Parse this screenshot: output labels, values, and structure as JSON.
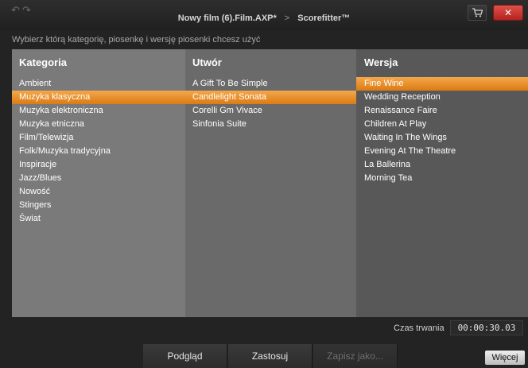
{
  "titlebar": {
    "undo_glyph": "↶",
    "redo_glyph": "↷",
    "project_title": "Nowy film (6).Film.AXP*",
    "arrow": ">",
    "app_name": "Scorefitter™",
    "cart_icon": "shopping-cart-icon",
    "close_glyph": "✕"
  },
  "instruction": "Wybierz którą kategorię, piosenkę i wersję piosenki chcesz użyć",
  "columns": {
    "category": {
      "header": "Kategoria",
      "items": [
        "Ambient",
        "Muzyka klasyczna",
        "Muzyka elektroniczna",
        "Muzyka etniczna",
        "Film/Telewizja",
        "Folk/Muzyka tradycyjna",
        "Inspiracje",
        "Jazz/Blues",
        "Nowość",
        "Stingers",
        "Świat"
      ],
      "selected_index": 1
    },
    "song": {
      "header": "Utwór",
      "items": [
        "A Gift To Be Simple",
        "Candlelight Sonata",
        "Corelli Gm Vivace",
        "Sinfonia Suite"
      ],
      "selected_index": 1
    },
    "version": {
      "header": "Wersja",
      "items": [
        "Fine Wine",
        "Wedding Reception",
        "Renaissance Faire",
        "Children At Play",
        "Waiting In The Wings",
        "Evening At The Theatre",
        "La Ballerina",
        "Morning Tea"
      ],
      "selected_index": 0
    }
  },
  "duration": {
    "label": "Czas trwania",
    "value": "00:00:30.03"
  },
  "buttons": {
    "preview": "Podgląd",
    "apply": "Zastosuj",
    "save_as": "Zapisz jako...",
    "more": "Więcej"
  },
  "colors": {
    "selection": "#e88a24",
    "close_button": "#c93530"
  }
}
